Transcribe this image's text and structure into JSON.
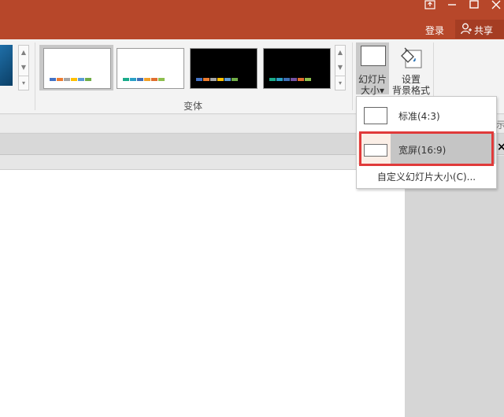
{
  "titlebar": {
    "bg": "#b7472a",
    "login_label": "登录",
    "share_label": "共享",
    "window_buttons": [
      "pin-icon",
      "minimize-icon",
      "close-icon"
    ]
  },
  "ribbon": {
    "group_label": "变体",
    "variants": [
      {
        "theme": "white",
        "swatches": [
          "#4472c4",
          "#ed7d31",
          "#a5a5a5",
          "#ffc000",
          "#5b9bd5",
          "#70ad47"
        ]
      },
      {
        "theme": "white",
        "swatches": [
          "#1aab8a",
          "#2aa0c7",
          "#3f6fb6",
          "#f1a029",
          "#e06d2d",
          "#8dbe4d"
        ]
      },
      {
        "theme": "black",
        "swatches": [
          "#4472c4",
          "#ed7d31",
          "#a5a5a5",
          "#ffc000",
          "#5b9bd5",
          "#70ad47"
        ]
      },
      {
        "theme": "black",
        "swatches": [
          "#1aab8a",
          "#2aa0c7",
          "#3f6fb6",
          "#7452a3",
          "#e06d2d",
          "#8dbe4d"
        ]
      }
    ],
    "slide_size": {
      "line1": "幻灯片",
      "line2": "大小▾"
    },
    "format_bg": {
      "line1": "设置",
      "line2": "背景格式"
    },
    "clipped_text": "示"
  },
  "dropdown": {
    "items": [
      {
        "label": "标准(4:3)"
      },
      {
        "label": "宽屏(16:9)"
      }
    ],
    "custom_label": "自定义幻灯片大小(C)..."
  },
  "pane": {
    "close": "×"
  }
}
